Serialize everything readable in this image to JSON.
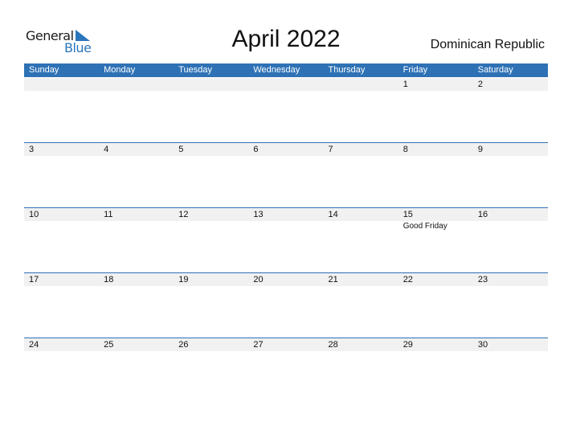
{
  "logo": {
    "line1": "General",
    "line2": "Blue"
  },
  "header": {
    "title": "April 2022",
    "country": "Dominican Republic"
  },
  "colors": {
    "accent": "#2e72b5",
    "strip": "#f1f1f1"
  },
  "weekdays": [
    "Sunday",
    "Monday",
    "Tuesday",
    "Wednesday",
    "Thursday",
    "Friday",
    "Saturday"
  ],
  "weeks": [
    [
      {
        "day": ""
      },
      {
        "day": ""
      },
      {
        "day": ""
      },
      {
        "day": ""
      },
      {
        "day": ""
      },
      {
        "day": "1"
      },
      {
        "day": "2"
      }
    ],
    [
      {
        "day": "3"
      },
      {
        "day": "4"
      },
      {
        "day": "5"
      },
      {
        "day": "6"
      },
      {
        "day": "7"
      },
      {
        "day": "8"
      },
      {
        "day": "9"
      }
    ],
    [
      {
        "day": "10"
      },
      {
        "day": "11"
      },
      {
        "day": "12"
      },
      {
        "day": "13"
      },
      {
        "day": "14"
      },
      {
        "day": "15",
        "holiday": "Good Friday"
      },
      {
        "day": "16"
      }
    ],
    [
      {
        "day": "17"
      },
      {
        "day": "18"
      },
      {
        "day": "19"
      },
      {
        "day": "20"
      },
      {
        "day": "21"
      },
      {
        "day": "22"
      },
      {
        "day": "23"
      }
    ],
    [
      {
        "day": "24"
      },
      {
        "day": "25"
      },
      {
        "day": "26"
      },
      {
        "day": "27"
      },
      {
        "day": "28"
      },
      {
        "day": "29"
      },
      {
        "day": "30"
      }
    ]
  ]
}
